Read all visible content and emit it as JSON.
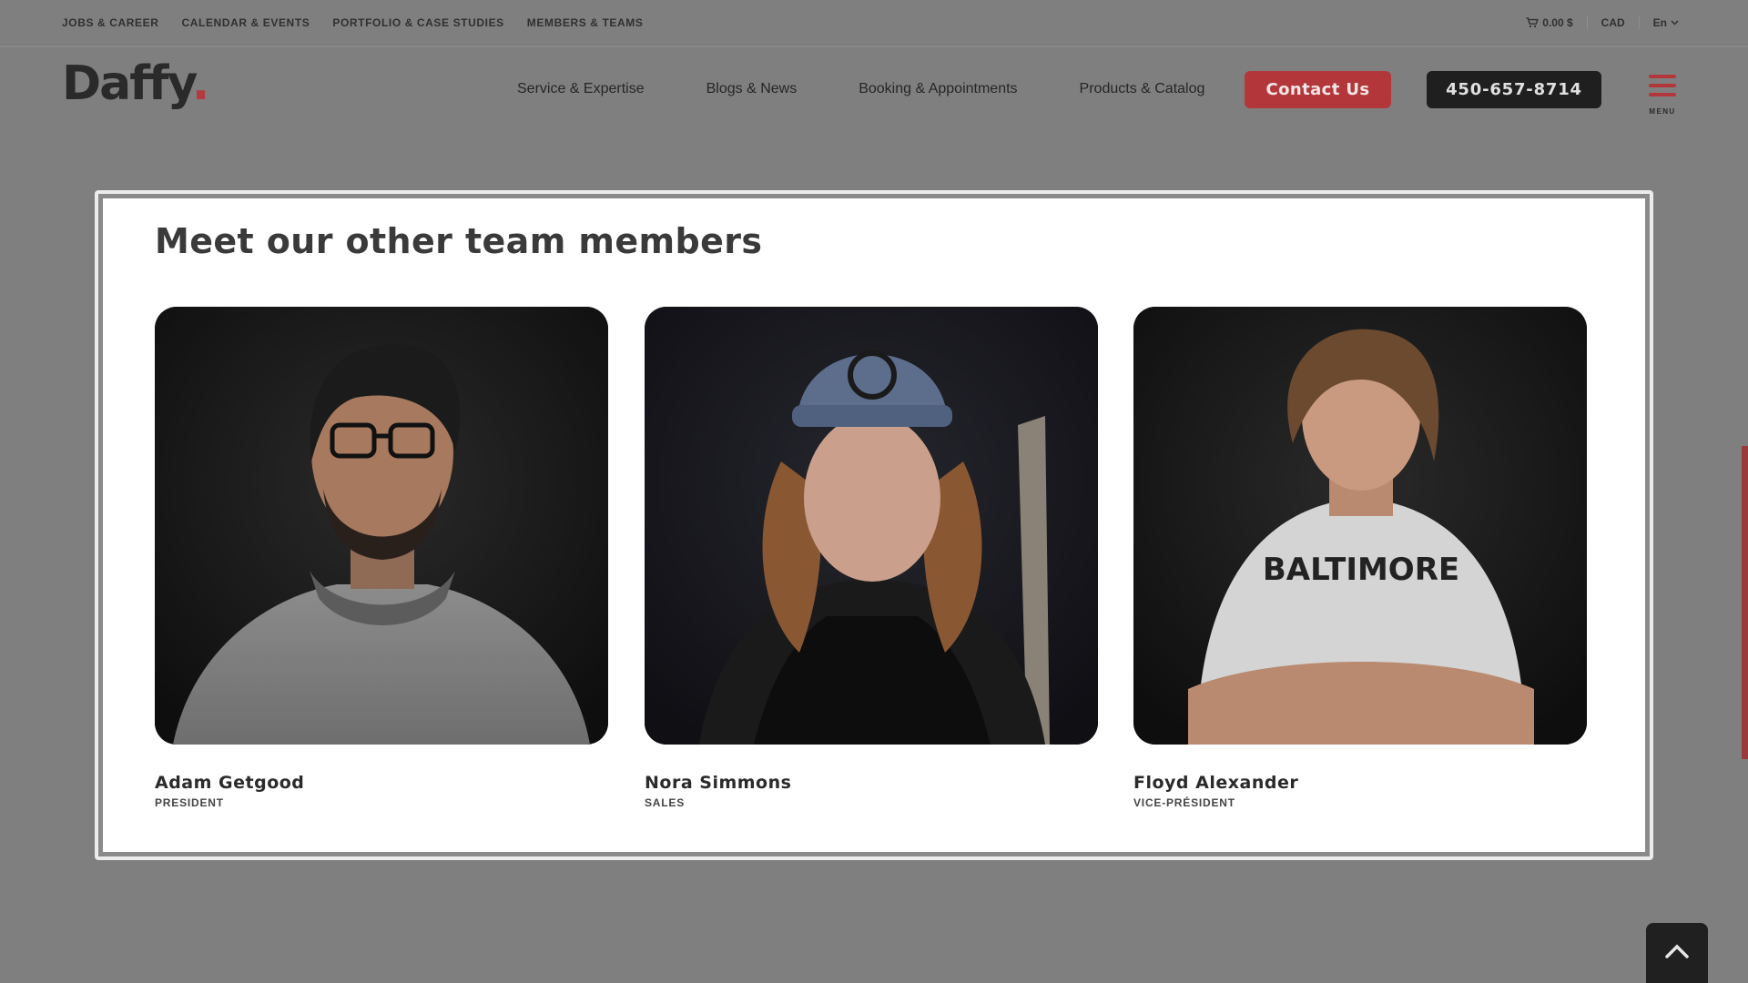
{
  "topbar": {
    "links": [
      "Jobs & Career",
      "Calendar & Events",
      "Portfolio & Case Studies",
      "Members & Teams"
    ],
    "cart_total": "0.00 $",
    "currency": "CAD",
    "language": "En"
  },
  "header": {
    "logo_text": "Daffy",
    "logo_dot": ".",
    "nav": [
      "Service & Expertise",
      "Blogs & News",
      "Booking & Appointments",
      "Products & Catalog"
    ],
    "contact_label": "Contact Us",
    "phone": "450-657-8714",
    "menu_label": "MENU"
  },
  "team_section": {
    "title": "Meet our other team members",
    "members": [
      {
        "name": "Adam Getgood",
        "role": "President"
      },
      {
        "name": "Nora Simmons",
        "role": "Sales"
      },
      {
        "name": "Floyd Alexander",
        "role": "Vice-président",
        "shirt_text": "BALTIMORE"
      }
    ]
  },
  "colors": {
    "overlay": "#7f7f7f",
    "accent": "#b3373a",
    "dark": "#1f1f1f"
  },
  "icons": [
    "cart-icon",
    "chevron-down-icon",
    "hamburger-menu-icon",
    "chevron-up-icon"
  ]
}
